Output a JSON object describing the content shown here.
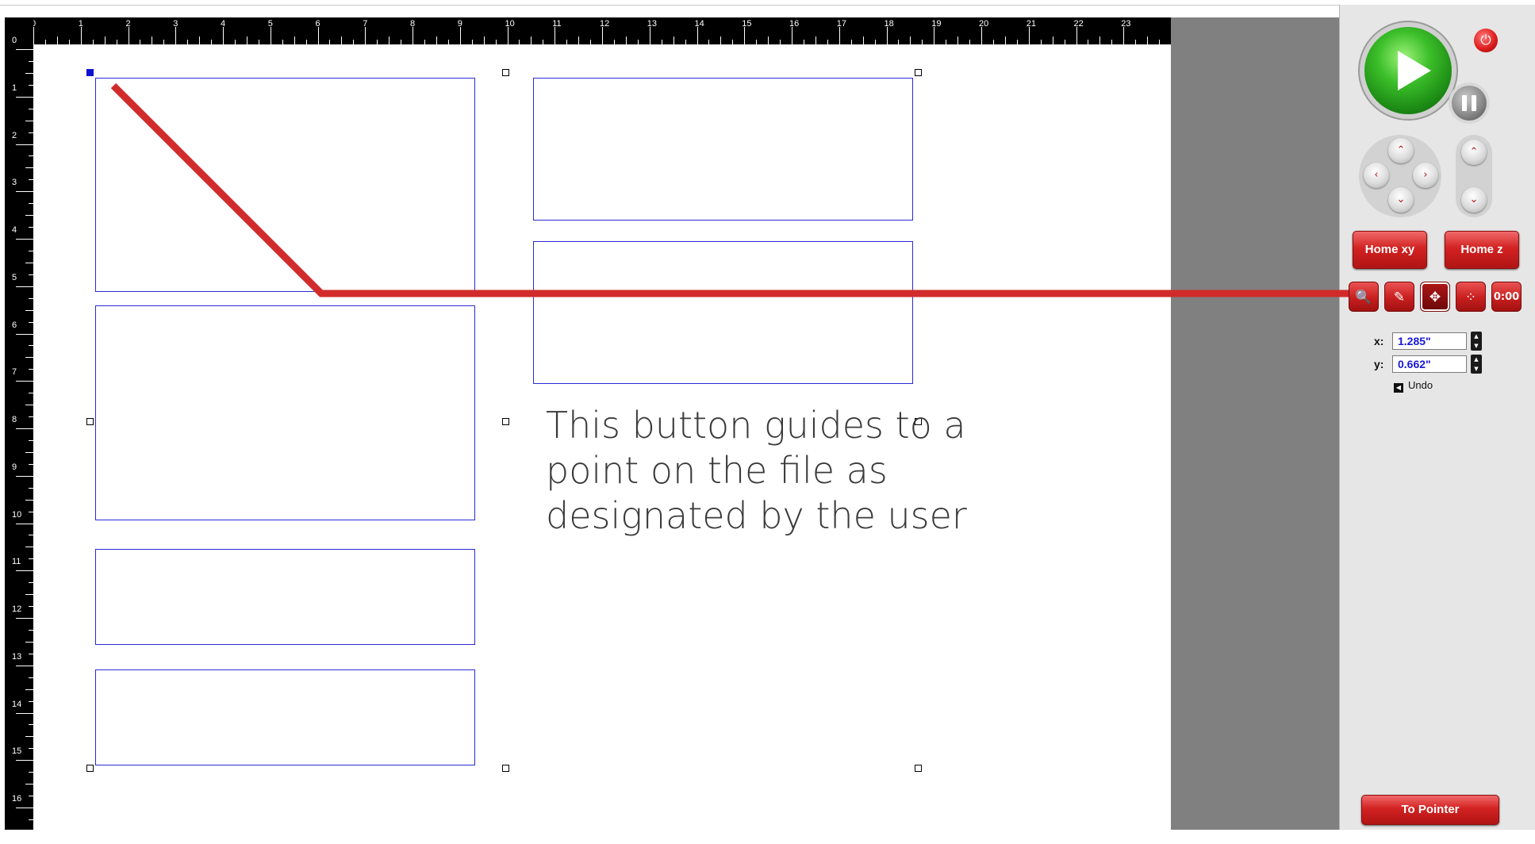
{
  "ruler": {
    "top_labels": [
      "0",
      "1",
      "2",
      "3",
      "4",
      "5",
      "6",
      "7",
      "8",
      "9",
      "10",
      "11",
      "12",
      "13",
      "14",
      "15",
      "16",
      "17",
      "18",
      "19",
      "20",
      "21",
      "22",
      "23"
    ],
    "left_labels": [
      "0",
      "1",
      "2",
      "3",
      "4",
      "5",
      "6",
      "7",
      "8",
      "9",
      "10",
      "11",
      "12",
      "13",
      "14",
      "15",
      "16"
    ]
  },
  "annotation": {
    "text": "This button guides to a point on the file as designated by the user"
  },
  "panel": {
    "power_symbol": "⏻",
    "home_xy_label": "Home xy",
    "home_z_label": "Home z",
    "tools": [
      {
        "icon": "zoom-icon",
        "glyph": "🔍"
      },
      {
        "icon": "pen-icon",
        "glyph": "✎"
      },
      {
        "icon": "move-arrows-icon",
        "glyph": "✥"
      },
      {
        "icon": "nodes-icon",
        "glyph": "⁘"
      },
      {
        "icon": "timer-icon",
        "glyph": "0:00"
      }
    ],
    "x_label": "x:",
    "x_value": "1.285\"",
    "y_label": "y:",
    "y_value": "0.662\"",
    "undo_label": "Undo",
    "to_pointer_label": "To Pointer"
  },
  "colors": {
    "accent_red": "#d12b2b",
    "part_outline": "#2a2ad4",
    "workspace_gray": "#808080",
    "panel_gray": "#e6e6e6",
    "coord_text": "#1818d8"
  }
}
